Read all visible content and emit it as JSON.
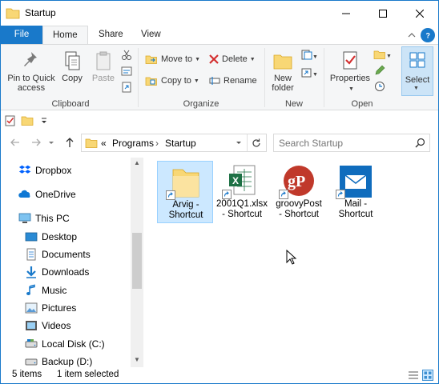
{
  "window": {
    "title": "Startup"
  },
  "tabs": [
    {
      "label": "File"
    },
    {
      "label": "Home"
    },
    {
      "label": "Share"
    },
    {
      "label": "View"
    }
  ],
  "ribbon": {
    "clipboard": {
      "label": "Clipboard",
      "pin_line1": "Pin to Quick",
      "pin_line2": "access",
      "copy": "Copy",
      "paste": "Paste"
    },
    "organize": {
      "label": "Organize",
      "move_to": "Move to",
      "copy_to": "Copy to",
      "delete": "Delete",
      "rename": "Rename"
    },
    "new": {
      "label": "New",
      "new_folder_line1": "New",
      "new_folder_line2": "folder"
    },
    "open": {
      "label": "Open",
      "properties": "Properties"
    },
    "select": {
      "label": "Select"
    }
  },
  "address": {
    "overflow": "«",
    "crumbs": [
      "Programs",
      "Startup"
    ]
  },
  "search": {
    "placeholder": "Search Startup"
  },
  "nav_pane": {
    "items": [
      {
        "label": "Dropbox",
        "icon": "dropbox-icon"
      },
      {
        "label": "OneDrive",
        "icon": "onedrive-icon"
      },
      {
        "label": "This PC",
        "icon": "computer-icon"
      },
      {
        "label": "Desktop",
        "icon": "desktop-icon"
      },
      {
        "label": "Documents",
        "icon": "documents-icon"
      },
      {
        "label": "Downloads",
        "icon": "downloads-icon"
      },
      {
        "label": "Music",
        "icon": "music-icon"
      },
      {
        "label": "Pictures",
        "icon": "pictures-icon"
      },
      {
        "label": "Videos",
        "icon": "videos-icon"
      },
      {
        "label": "Local Disk (C:)",
        "icon": "drive-icon"
      },
      {
        "label": "Backup (D:)",
        "icon": "drive-icon"
      }
    ]
  },
  "files": [
    {
      "line1": "Arvig -",
      "line2": "Shortcut",
      "icon": "folder-icon",
      "selected": true
    },
    {
      "line1": "2001Q1.xlsx",
      "line2": "- Shortcut",
      "icon": "excel-icon",
      "selected": false
    },
    {
      "line1": "groovyPost",
      "line2": "- Shortcut",
      "icon": "groovypost-icon",
      "selected": false
    },
    {
      "line1": "Mail -",
      "line2": "Shortcut",
      "icon": "mail-icon",
      "selected": false
    }
  ],
  "status": {
    "item_count": "5 items",
    "selection": "1 item selected"
  },
  "colors": {
    "accent": "#1979ca",
    "selection": "#cce8ff",
    "folder": "#f8d775",
    "excel": "#1e7145",
    "groovypost": "#c0392b",
    "mail": "#0f6cbd"
  }
}
